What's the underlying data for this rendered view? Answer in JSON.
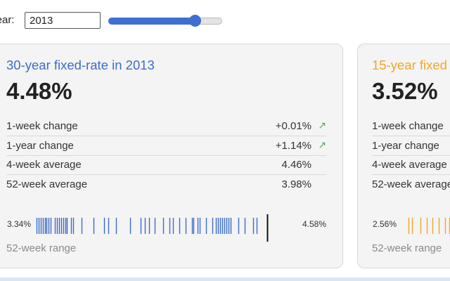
{
  "controls": {
    "year_label": "Year:",
    "year_value": "2013",
    "slider_fraction": 0.76
  },
  "colors": {
    "blue": "#3d6cc9",
    "orange": "#f0a62a",
    "positive_arrow": "#55a760"
  },
  "cards": [
    {
      "title": "30-year fixed-rate in 2013",
      "rate": "4.48%",
      "stats": [
        {
          "label": "1-week change",
          "value": "+0.01%",
          "arrow": "↗"
        },
        {
          "label": "1-year change",
          "value": "+1.14%",
          "arrow": "↗"
        },
        {
          "label": "4-week average",
          "value": "4.46%",
          "arrow": ""
        },
        {
          "label": "52-week average",
          "value": "3.98%",
          "arrow": ""
        }
      ],
      "range_min": "3.34%",
      "range_max": "4.58%",
      "range_label": "52-week range",
      "week_rates": [
        3.35,
        3.36,
        3.37,
        3.38,
        3.39,
        3.4,
        3.41,
        3.42,
        3.44,
        3.45,
        3.46,
        3.47,
        3.48,
        3.49,
        3.5,
        3.52,
        3.53,
        3.57,
        3.63,
        3.68,
        3.7,
        3.74,
        3.81,
        3.86,
        3.88,
        3.9,
        3.93,
        3.97,
        4.0,
        4.02,
        4.05,
        4.08,
        4.11,
        4.12,
        4.14,
        4.15,
        4.18,
        4.21,
        4.23,
        4.24,
        4.25,
        4.26,
        4.27,
        4.28,
        4.29,
        4.3,
        4.34,
        4.37,
        4.41,
        4.43,
        4.52,
        4.56
      ],
      "current_rate": 4.48
    },
    {
      "title": "15-year fixed",
      "rate": "3.52%",
      "stats": [
        {
          "label": "1-week change",
          "value": "",
          "arrow": ""
        },
        {
          "label": "1-year change",
          "value": "",
          "arrow": ""
        },
        {
          "label": "4-week average",
          "value": "",
          "arrow": ""
        },
        {
          "label": "52-week average",
          "value": "",
          "arrow": ""
        }
      ],
      "range_min": "2.56%",
      "range_max": "",
      "range_label": "52-week range",
      "week_rates": [
        2.6,
        2.62,
        2.66,
        2.69,
        2.72,
        2.75,
        2.78,
        2.8
      ],
      "current_rate": null
    }
  ]
}
